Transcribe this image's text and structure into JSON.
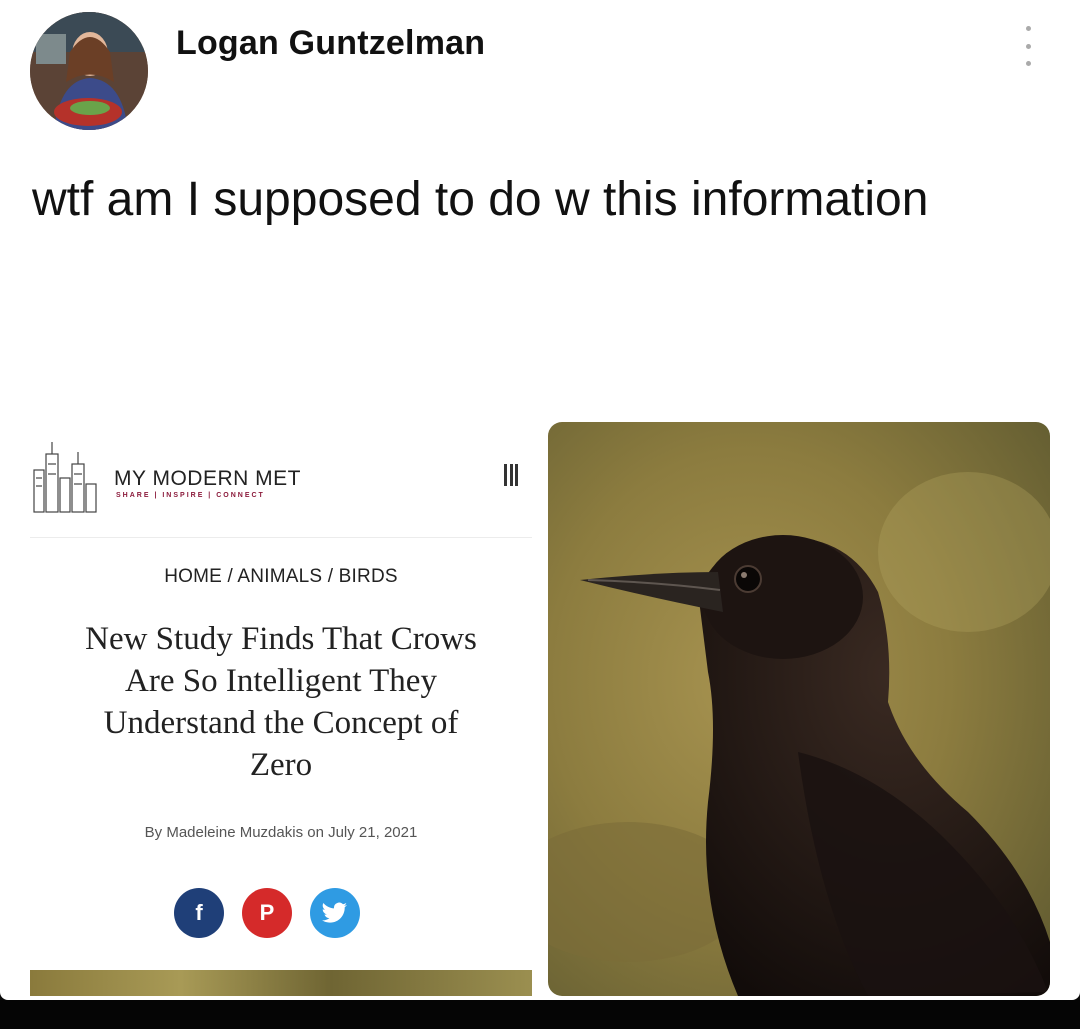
{
  "post": {
    "author": "Logan Guntzelman",
    "text": "wtf am I supposed to do w this information"
  },
  "article": {
    "site_name": "MY MODERN MET",
    "site_tagline": "SHARE | INSPIRE | CONNECT",
    "breadcrumb": "HOME / ANIMALS / BIRDS",
    "headline_lines": [
      "New Study Finds That Crows",
      "Are So Intelligent They",
      "Understand the Concept of",
      "Zero"
    ],
    "byline": "By Madeleine Muzdakis on July 21, 2021",
    "social_icons": [
      "facebook-icon",
      "pinterest-icon",
      "twitter-icon"
    ],
    "social_glyphs": {
      "facebook": "f",
      "pinterest": "P"
    }
  },
  "colors": {
    "facebook": "#1f3f78",
    "pinterest": "#d52a2a",
    "twitter": "#2f9be3",
    "site_tagline": "#8b1a3b"
  }
}
